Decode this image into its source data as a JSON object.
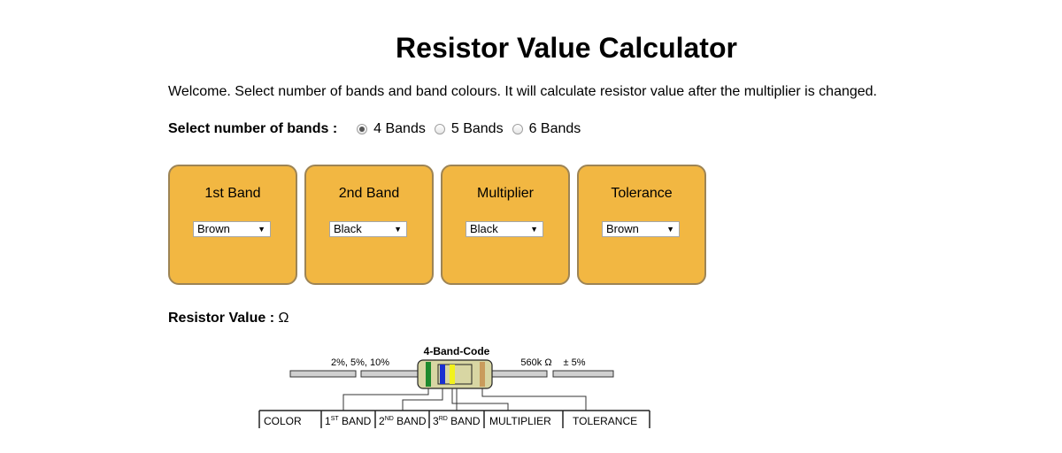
{
  "page": {
    "title": "Resistor Value Calculator",
    "welcome": "Welcome. Select number of bands and band colours. It will calculate resistor value after the multiplier is changed."
  },
  "band_selector": {
    "label": "Select number of bands :",
    "options": [
      {
        "label": "4 Bands",
        "checked": true
      },
      {
        "label": "5 Bands",
        "checked": false
      },
      {
        "label": "6 Bands",
        "checked": false
      }
    ]
  },
  "cards": [
    {
      "title": "1st Band",
      "selected": "Brown"
    },
    {
      "title": "2nd Band",
      "selected": "Black"
    },
    {
      "title": "Multiplier",
      "selected": "Black"
    },
    {
      "title": "Tolerance",
      "selected": "Brown"
    }
  ],
  "result": {
    "label": "Resistor Value :",
    "unit": "Ω"
  },
  "diagram": {
    "heading": "4-Band-Code",
    "left_caption": "2%, 5%, 10%",
    "right_value": "560k Ω",
    "right_tolerance": "± 5%",
    "table_headers": [
      "COLOR",
      "1",
      "ST",
      " BAND",
      "2",
      "ND",
      " BAND",
      "3",
      "RD",
      " BAND",
      "MULTIPLIER",
      "TOLERANCE"
    ]
  },
  "colors": {
    "card_bg": "#f2b742",
    "card_border": "#9d8455",
    "resistor_body": "#d8d6a3",
    "band_green": "#1e8a2e",
    "band_blue": "#1a2fd0",
    "band_yellow": "#f2f21b",
    "band_tan": "#c99b5c"
  }
}
